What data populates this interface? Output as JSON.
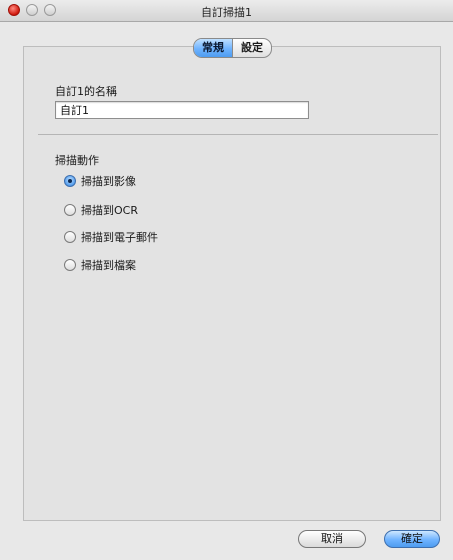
{
  "window": {
    "title": "自訂掃描1"
  },
  "tabs": [
    {
      "label": "常規",
      "active": true
    },
    {
      "label": "設定",
      "active": false
    }
  ],
  "name_section": {
    "label": "自訂1的名稱",
    "value": "自訂1"
  },
  "scan_action": {
    "label": "掃描動作",
    "options": [
      {
        "label": "掃描到影像",
        "selected": true
      },
      {
        "label": "掃描到OCR",
        "selected": false
      },
      {
        "label": "掃描到電子郵件",
        "selected": false
      },
      {
        "label": "掃描到檔案",
        "selected": false
      }
    ]
  },
  "buttons": {
    "cancel": "取消",
    "ok": "確定"
  },
  "colors": {
    "accent": "#4e9cf0",
    "close_button": "#d0180c"
  }
}
